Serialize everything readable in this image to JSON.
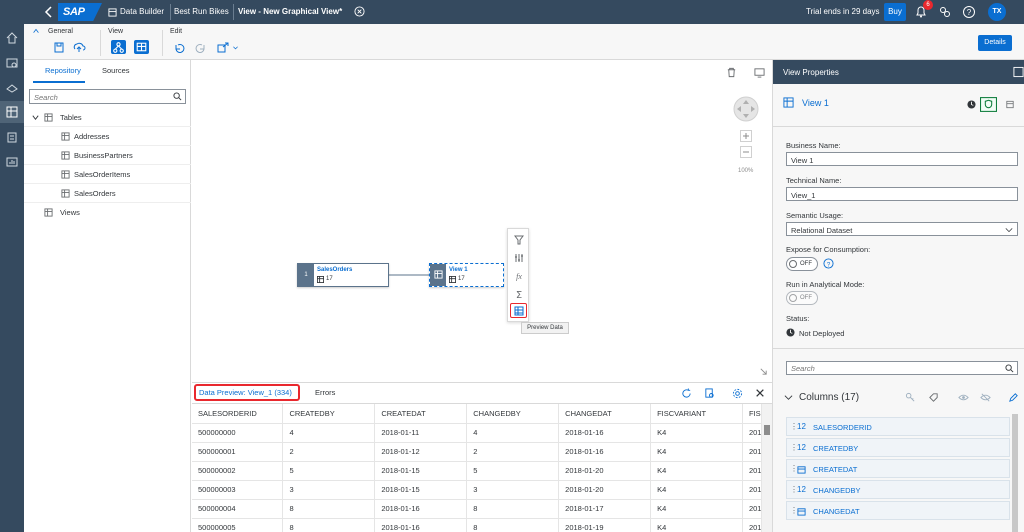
{
  "shell": {
    "logo": "SAP",
    "breadcrumb": [
      "Data Builder",
      "Best Run Bikes",
      "View - New Graphical View*"
    ],
    "trial": "Trial ends in 29 days",
    "buy": "Buy",
    "notifications": "6",
    "avatar": "TX"
  },
  "toolbar": {
    "general": "General",
    "view": "View",
    "edit": "Edit",
    "details": "Details"
  },
  "repo": {
    "tabs": [
      "Repository",
      "Sources"
    ],
    "search_placeholder": "Search",
    "tables_label": "Tables",
    "tables": [
      "Addresses",
      "BusinessPartners",
      "SalesOrderItems",
      "SalesOrders"
    ],
    "views_label": "Views"
  },
  "canvas": {
    "source_node": {
      "index": "1",
      "title": "SalesOrders",
      "count": "17"
    },
    "view_node": {
      "title": "View 1",
      "count": "17"
    },
    "zoom": "100%",
    "tooltip": "Preview Data"
  },
  "preview": {
    "tab": "Data Preview: View_1 (334)",
    "errors": "Errors",
    "columns": [
      "SALESORDERID",
      "CREATEDBY",
      "CREATEDAT",
      "CHANGEDBY",
      "CHANGEDAT",
      "FISCVARIANT",
      "FISC"
    ],
    "rows": [
      [
        "500000000",
        "4",
        "2018-01-11",
        "4",
        "2018-01-16",
        "K4",
        "201"
      ],
      [
        "500000001",
        "2",
        "2018-01-12",
        "2",
        "2018-01-16",
        "K4",
        "201"
      ],
      [
        "500000002",
        "5",
        "2018-01-15",
        "5",
        "2018-01-20",
        "K4",
        "201"
      ],
      [
        "500000003",
        "3",
        "2018-01-15",
        "3",
        "2018-01-20",
        "K4",
        "201"
      ],
      [
        "500000004",
        "8",
        "2018-01-16",
        "8",
        "2018-01-17",
        "K4",
        "201"
      ],
      [
        "500000005",
        "8",
        "2018-01-16",
        "8",
        "2018-01-19",
        "K4",
        "201"
      ]
    ]
  },
  "properties": {
    "header": "View Properties",
    "view_name": "View 1",
    "business_name_label": "Business Name:",
    "business_name": "View 1",
    "technical_name_label": "Technical Name:",
    "technical_name": "View_1",
    "semantic_usage_label": "Semantic Usage:",
    "semantic_usage": "Relational Dataset",
    "expose_label": "Expose for Consumption:",
    "expose_value": "OFF",
    "analytical_label": "Run in Analytical Mode:",
    "analytical_value": "OFF",
    "status_label": "Status:",
    "status": "Not Deployed",
    "search_placeholder": "Search",
    "columns_title": "Columns (17)",
    "columns": [
      {
        "type": "12",
        "name": "SALESORDERID"
      },
      {
        "type": "12",
        "name": "CREATEDBY"
      },
      {
        "type": "cal",
        "name": "CREATEDAT"
      },
      {
        "type": "12",
        "name": "CHANGEDBY"
      },
      {
        "type": "cal",
        "name": "CHANGEDAT"
      }
    ]
  },
  "colors": {
    "shell": "#354a5f",
    "accent": "#0a6ed1",
    "highlight": "#e9282e"
  }
}
